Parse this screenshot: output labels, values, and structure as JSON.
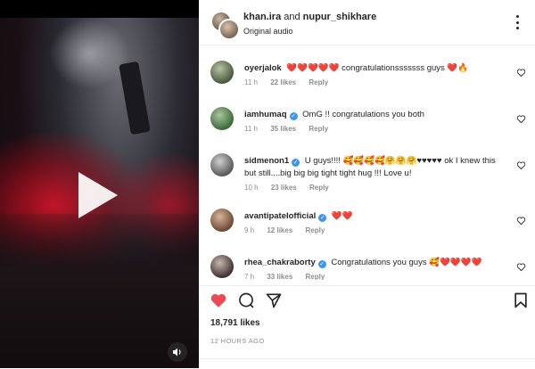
{
  "post": {
    "user1": "khan.ira",
    "connector": "and",
    "user2": "nupur_shikhare",
    "audio": "Original audio"
  },
  "comments": [
    {
      "user": "oyerjalok",
      "verified": false,
      "text": "❤️❤️❤️❤️❤️ congratulationsssssss guys ❤️🔥",
      "time": "11 h",
      "likes": "22 likes",
      "reply": "Reply"
    },
    {
      "user": "iamhumaq",
      "verified": true,
      "text": "OmG !! congratulations you both",
      "time": "11 h",
      "likes": "35 likes",
      "reply": "Reply"
    },
    {
      "user": "sidmenon1",
      "verified": true,
      "text": "U guys!!!! 🥰🥰🥰🥰🤗🤗🤗♥♥♥♥♥ ok I knew this but still....big big big tight tight hug !!! Love u!",
      "time": "10 h",
      "likes": "23 likes",
      "reply": "Reply"
    },
    {
      "user": "avantipateIofficial",
      "verified": true,
      "text": "❤️❤️",
      "time": "9 h",
      "likes": "12 likes",
      "reply": "Reply"
    },
    {
      "user": "rhea_chakraborty",
      "verified": true,
      "text": "Congratulations you guys 🥰❤️❤️❤️❤️",
      "time": "7 h",
      "likes": "33 likes",
      "reply": "Reply"
    }
  ],
  "footer": {
    "likes": "18,791 likes",
    "time_ago": "12 HOURS AGO"
  },
  "icons": {
    "like": "heart-filled-icon",
    "comment": "comment-icon",
    "share": "share-icon",
    "save": "bookmark-icon",
    "more": "more-icon",
    "play": "play-icon",
    "sound": "speaker-icon"
  },
  "colors": {
    "like_red": "#ed4956",
    "verified_blue": "#3897f0",
    "muted_gray": "#8e8e8e"
  }
}
